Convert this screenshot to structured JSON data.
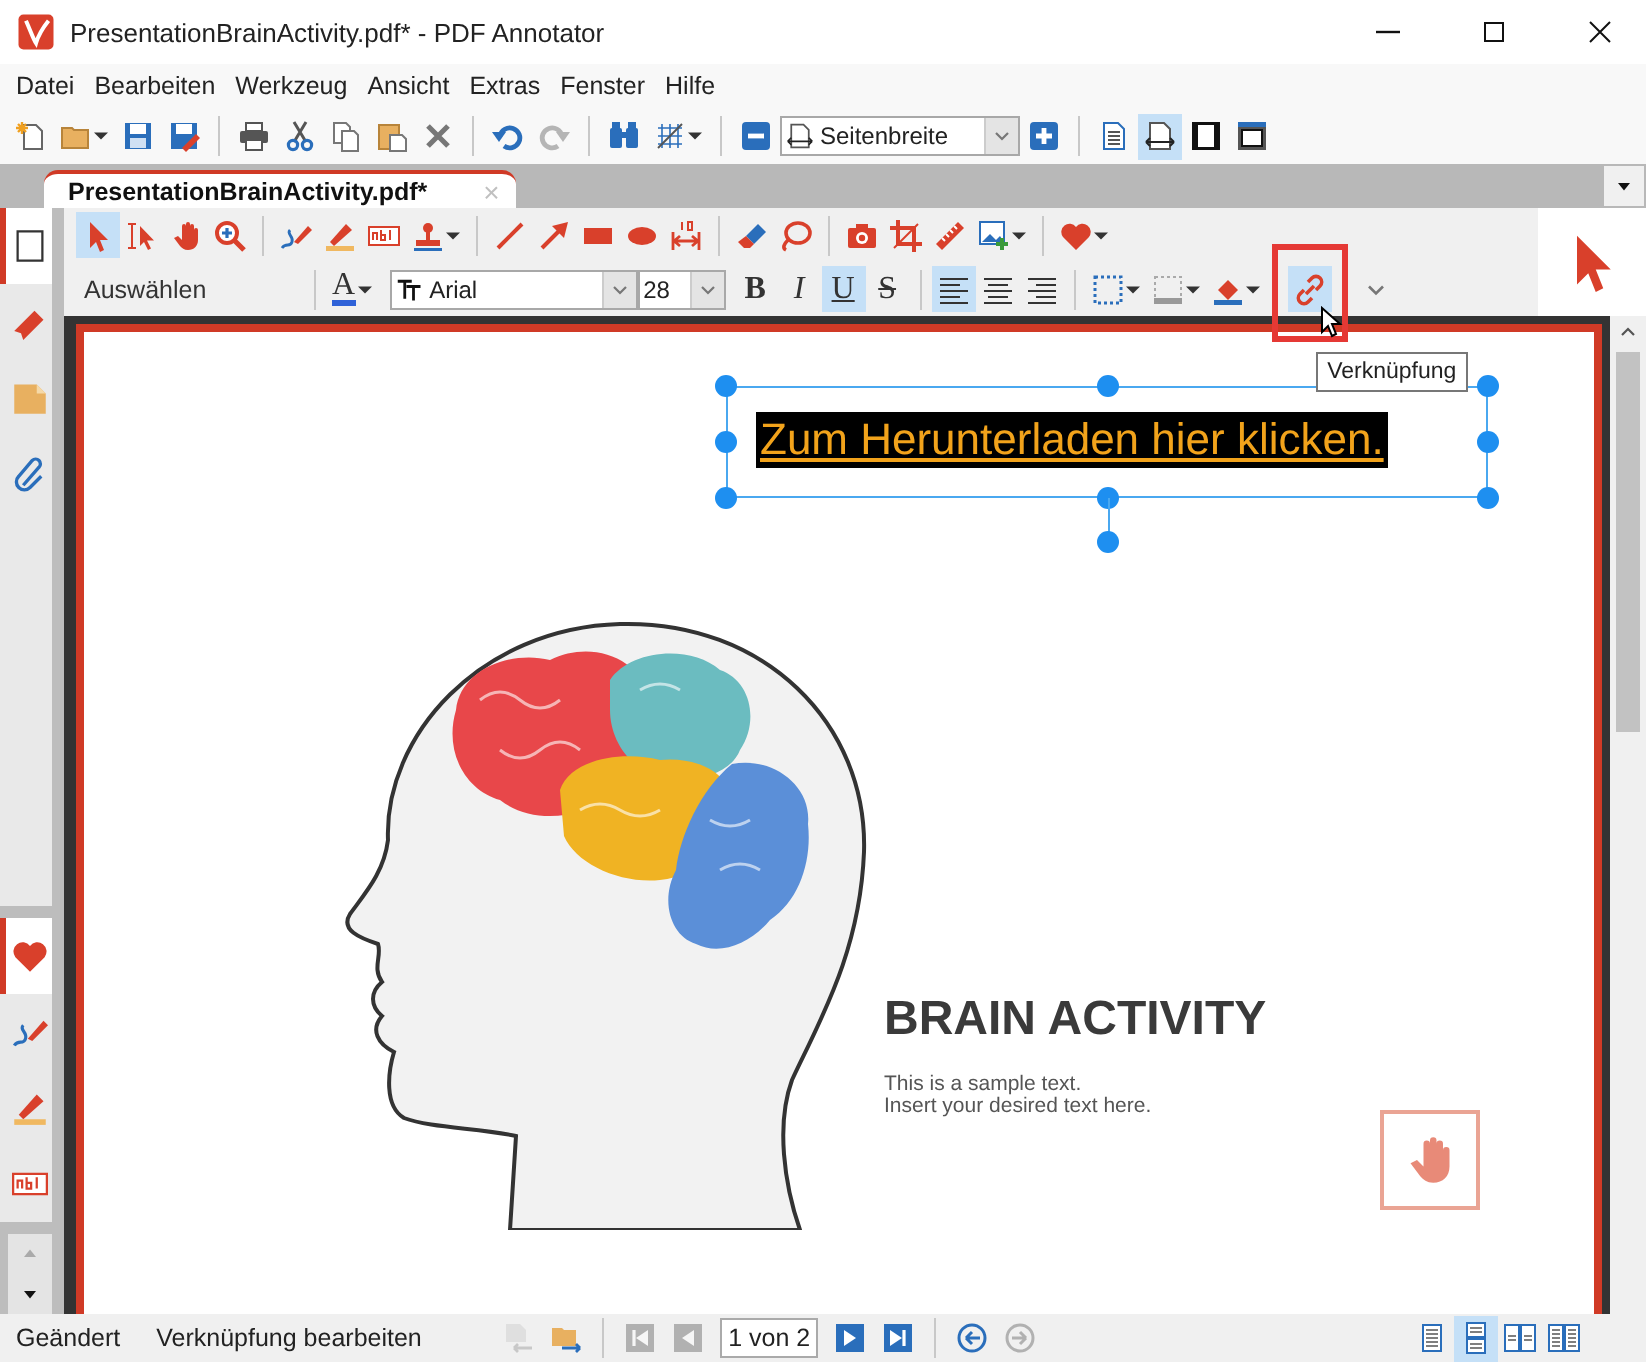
{
  "window": {
    "title": "PresentationBrainActivity.pdf* - PDF Annotator"
  },
  "menu": [
    "Datei",
    "Bearbeiten",
    "Werkzeug",
    "Ansicht",
    "Extras",
    "Fenster",
    "Hilfe"
  ],
  "toolbar": {
    "undo": {
      "disabled": false
    },
    "redo": {
      "disabled": true
    },
    "zoom": "Seitenbreite",
    "view_modes": [
      {
        "selected": false
      },
      {
        "selected": true
      },
      {
        "selected": false
      },
      {
        "selected": false
      }
    ]
  },
  "document_tab": {
    "label": "PresentationBrainActivity.pdf*",
    "close": "×",
    "selected": true
  },
  "sidebar": {
    "top_tabs": [
      {
        "selected": true
      },
      {
        "selected": false
      },
      {
        "selected": false
      },
      {
        "selected": false
      }
    ],
    "bottom_tabs": [
      {
        "selected": true
      },
      {
        "selected": false
      },
      {
        "selected": false
      },
      {
        "selected": false
      }
    ]
  },
  "tools": [
    {
      "selected": true
    },
    {
      "selected": false
    },
    {
      "selected": false
    },
    {
      "selected": false
    },
    {
      "selected": false
    },
    {
      "selected": false
    },
    {
      "selected": false
    },
    {
      "selected": false
    },
    {
      "selected": false
    },
    {
      "selected": false
    },
    {
      "selected": false
    },
    {
      "selected": false
    },
    {
      "selected": false
    },
    {
      "selected": false
    },
    {
      "selected": false
    },
    {
      "selected": false
    },
    {
      "selected": false
    },
    {
      "selected": false
    },
    {
      "selected": false
    },
    {
      "selected": false
    }
  ],
  "format_bar": {
    "tool_name": "Auswählen",
    "font_color": {
      "label": "A",
      "color": "#2f62d8"
    },
    "font": "Arial",
    "size": "28",
    "styles": [
      {
        "label": "B",
        "on": false
      },
      {
        "label": "I",
        "on": false
      },
      {
        "label": "U",
        "on": true
      },
      {
        "label": "S",
        "on": false
      }
    ],
    "align": [
      {
        "selected": true
      },
      {
        "selected": false
      },
      {
        "selected": false
      }
    ],
    "link_button": {
      "on": true,
      "highlighted": true
    }
  },
  "tooltip": "Verknüpfung",
  "page": {
    "link_text": "Zum Herunterladen hier klicken.",
    "link_selected": true,
    "heading": "BRAIN ACTIVITY",
    "body": [
      "This is a sample text.",
      "Insert your desired text here."
    ]
  },
  "status_bar": {
    "state": "Geändert",
    "action": "Verknüpfung bearbeiten",
    "page_field": "1 von 2",
    "nav": [
      {
        "disabled": true
      },
      {
        "disabled": true
      },
      {
        "disabled": false
      },
      {
        "disabled": false
      }
    ],
    "history": [
      {
        "disabled": false
      },
      {
        "disabled": true
      }
    ],
    "layouts": [
      {
        "selected": false
      },
      {
        "selected": true
      },
      {
        "selected": false
      },
      {
        "selected": false
      }
    ]
  }
}
